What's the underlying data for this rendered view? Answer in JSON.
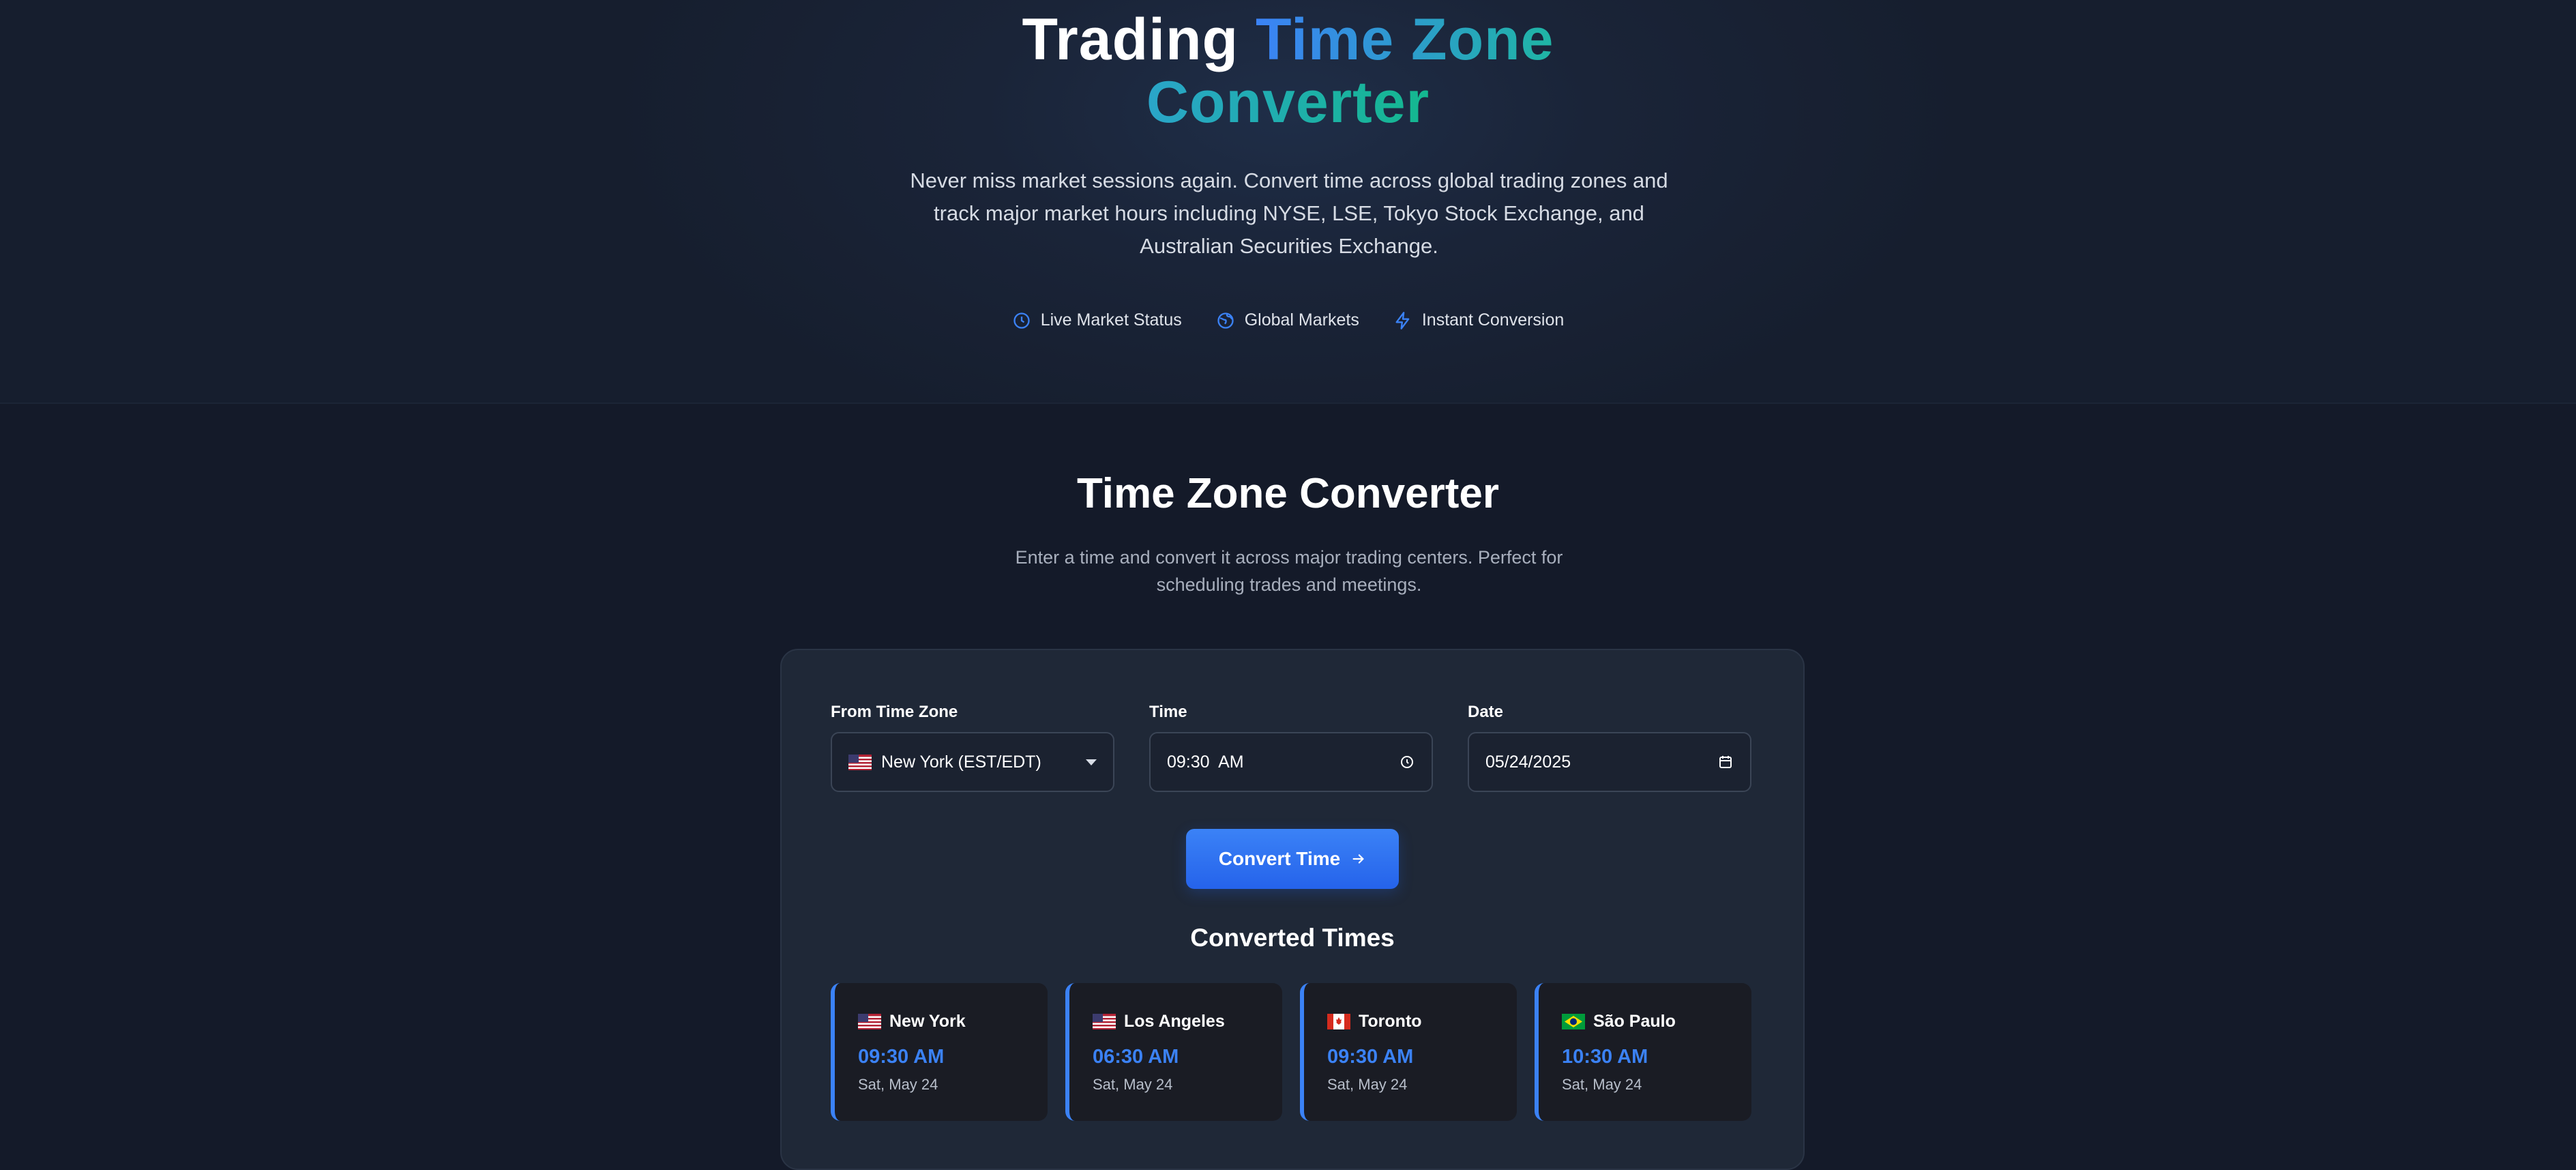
{
  "hero": {
    "title_part1": "Trading",
    "title_part2": "Time Zone",
    "title_part3": "Converter",
    "subtitle": "Never miss market sessions again. Convert time across global trading zones and track major market hours including NYSE, LSE, Tokyo Stock Exchange, and Australian Securities Exchange.",
    "features": [
      {
        "label": "Live Market Status",
        "icon": "clock-icon"
      },
      {
        "label": "Global Markets",
        "icon": "globe-icon"
      },
      {
        "label": "Instant Conversion",
        "icon": "lightning-icon"
      }
    ]
  },
  "section": {
    "title": "Time Zone Converter",
    "subtitle": "Enter a time and convert it across major trading centers. Perfect for scheduling trades and meetings."
  },
  "form": {
    "from_label": "From Time Zone",
    "from_value": "New York (EST/EDT)",
    "time_label": "Time",
    "time_value": "09:30  AM",
    "date_label": "Date",
    "date_value": "05/24/2025",
    "convert_label": "Convert Time"
  },
  "results": {
    "title": "Converted Times",
    "items": [
      {
        "city": "New York",
        "time": "09:30 AM",
        "date": "Sat, May 24",
        "flag": "us-flag"
      },
      {
        "city": "Los Angeles",
        "time": "06:30 AM",
        "date": "Sat, May 24",
        "flag": "us-flag"
      },
      {
        "city": "Toronto",
        "time": "09:30 AM",
        "date": "Sat, May 24",
        "flag": "canada-flag"
      },
      {
        "city": "São Paulo",
        "time": "10:30 AM",
        "date": "Sat, May 24",
        "flag": "brazil-flag"
      }
    ]
  },
  "colors": {
    "accent": "#3b82f6",
    "background": "#141a29",
    "card": "#1f2837",
    "teal": "#14b88f"
  }
}
